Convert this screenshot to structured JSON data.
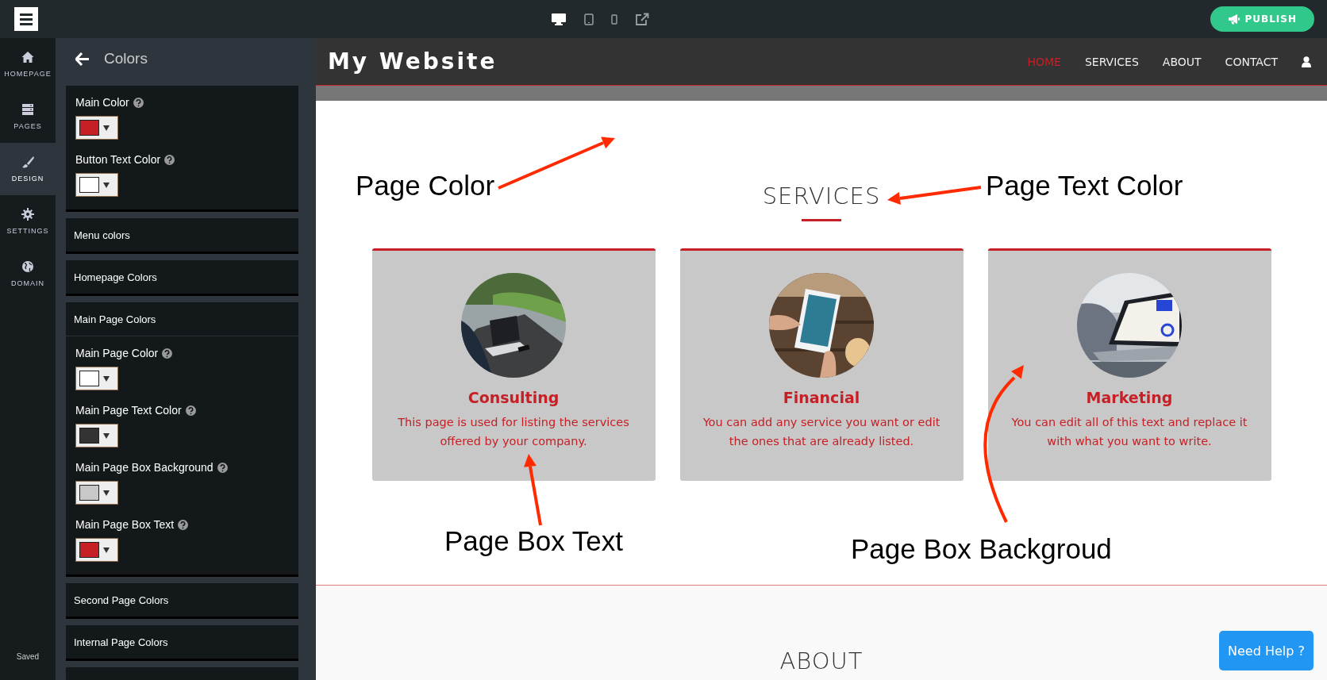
{
  "topbar": {
    "devices": [
      {
        "kind": "desktop",
        "selected": true
      },
      {
        "kind": "tablet",
        "selected": false
      },
      {
        "kind": "phone",
        "selected": false
      },
      {
        "kind": "external",
        "selected": false
      }
    ],
    "publish": "PUBLISH"
  },
  "nav": {
    "items": [
      {
        "label": "HOMEPAGE",
        "kind": "home",
        "selected": false
      },
      {
        "label": "PAGES",
        "kind": "pages",
        "selected": false
      },
      {
        "label": "DESIGN",
        "kind": "design",
        "selected": true
      },
      {
        "label": "SETTINGS",
        "kind": "settings",
        "selected": false
      },
      {
        "label": "DOMAIN",
        "kind": "domain",
        "selected": false
      }
    ],
    "status": "Saved"
  },
  "panel": {
    "title": "Colors",
    "sections": [
      {
        "fields": [
          {
            "label": "Main Color",
            "color": "#c62026"
          },
          {
            "label": "Button Text Color",
            "color": "#ffffff"
          }
        ]
      },
      {
        "title": "Menu colors"
      },
      {
        "title": "Homepage Colors"
      },
      {
        "title": "Main Page Colors",
        "fields": [
          {
            "label": "Main Page Color",
            "color": "#ffffff"
          },
          {
            "label": "Main Page Text Color",
            "color": "#333333"
          },
          {
            "label": "Main Page Box Background",
            "color": "#c8c8c8"
          },
          {
            "label": "Main Page Box Text",
            "color": "#c62026"
          }
        ]
      },
      {
        "title": "Second Page Colors"
      },
      {
        "title": "Internal Page Colors"
      },
      {
        "kind": "partial"
      }
    ]
  },
  "site": {
    "title": "My Website",
    "menu": [
      {
        "label": "HOME",
        "selected": true
      },
      {
        "label": "SERVICES",
        "selected": false
      },
      {
        "label": "ABOUT",
        "selected": false
      },
      {
        "label": "CONTACT",
        "selected": false
      }
    ],
    "section_title": "SERVICES",
    "cards": [
      {
        "title": "Consulting",
        "text": "This page is used for listing the services offered by your company."
      },
      {
        "title": "Financial",
        "text": "You can add any service you want or edit the ones that are already listed."
      },
      {
        "title": "Marketing",
        "text": "You can edit all of this text and replace it with what you want to write."
      }
    ],
    "next_section_title": "ABOUT"
  },
  "help": "Need Help ?",
  "annotations": [
    {
      "label": "Page Color"
    },
    {
      "label": "Page Text Color"
    },
    {
      "label": "Page Box Text"
    },
    {
      "label": "Page Box Backgroud"
    }
  ]
}
